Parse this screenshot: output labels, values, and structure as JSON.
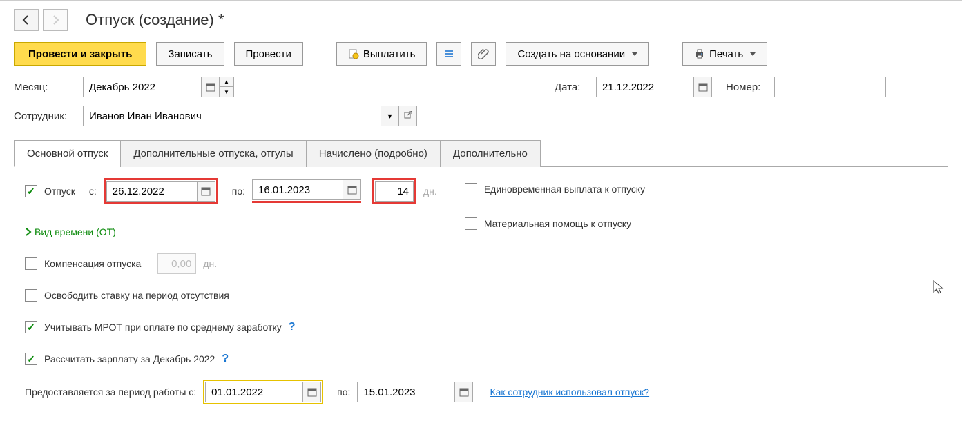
{
  "header": {
    "title": "Отпуск (создание) *"
  },
  "toolbar": {
    "post_close": "Провести и закрыть",
    "save": "Записать",
    "post": "Провести",
    "pay": "Выплатить",
    "create_on_basis": "Создать на основании",
    "print": "Печать"
  },
  "fields": {
    "month_label": "Месяц:",
    "month_value": "Декабрь 2022",
    "date_label": "Дата:",
    "date_value": "21.12.2022",
    "number_label": "Номер:",
    "number_value": "",
    "employee_label": "Сотрудник:",
    "employee_value": "Иванов Иван Иванович"
  },
  "tabs": [
    {
      "label": "Основной отпуск",
      "active": true
    },
    {
      "label": "Дополнительные отпуска, отгулы",
      "active": false
    },
    {
      "label": "Начислено (подробно)",
      "active": false
    },
    {
      "label": "Дополнительно",
      "active": false
    }
  ],
  "main_tab": {
    "vacation_label": "Отпуск",
    "from_label": "с:",
    "from_value": "26.12.2022",
    "to_label": "по:",
    "to_value": "16.01.2023",
    "days_value": "14",
    "days_unit": "дн.",
    "time_kind_link": "Вид времени (ОТ)",
    "lump_sum": "Единовременная выплата к отпуску",
    "material_help": "Материальная помощь к отпуску",
    "compensation_label": "Компенсация отпуска",
    "compensation_days": "0,00",
    "compensation_unit": "дн.",
    "release_rate": "Освободить ставку на период отсутствия",
    "account_mrot": "Учитывать МРОТ при оплате по среднему заработку",
    "calc_salary": "Рассчитать зарплату за Декабрь 2022",
    "period_label": "Предоставляется за период работы с:",
    "period_from": "01.01.2022",
    "period_to_label": "по:",
    "period_to": "15.01.2023",
    "usage_link": "Как сотрудник использовал отпуск?"
  }
}
